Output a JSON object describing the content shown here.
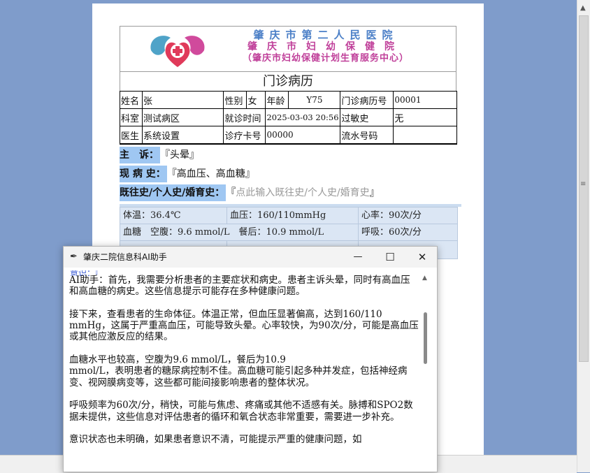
{
  "header": {
    "hospital_line1": "肇庆市第二人民医院",
    "hospital_line2": "肇庆市妇幼保健院",
    "hospital_line3": "（肇庆市妇幼保健计划生育服务中心）"
  },
  "record_title": "门诊病历",
  "info": {
    "name_label": "姓名",
    "name_value": "张",
    "gender_label": "性别",
    "gender_value": "女",
    "age_label": "年龄",
    "age_value": "Y75",
    "record_no_label": "门诊病历号",
    "record_no_value": "00001",
    "dept_label": "科室",
    "dept_value": "测试病区",
    "visit_time_label": "就诊时间",
    "visit_time_value": "2025-03-03 20:56",
    "allergy_label": "过敏史",
    "allergy_value": "无",
    "doctor_label": "医生",
    "doctor_value": "系统设置",
    "card_label": "诊疗卡号",
    "card_value": "00000",
    "serial_label": "流水号码",
    "serial_value": ""
  },
  "sections": {
    "chief_label": "主　诉：",
    "chief_value": "『头晕』",
    "present_label": "现 病 史：",
    "present_value": "『高血压、高血糖』",
    "past_label": "既往史/个人史/婚育史：",
    "past_open": "『",
    "past_placeholder": "点此输入既往史/个人史/婚育史",
    "past_close": "』"
  },
  "vitals": {
    "temp": "体温：36.4℃",
    "bp": "血压：160/110mmHg",
    "hr": "心率：90次/分",
    "glucose": "血糖　空腹：9.6 mmol/L　餐后：10.9 mmol/L",
    "resp": "呼吸：60次/分",
    "partial_row": "",
    "partial_right": ""
  },
  "ai_window": {
    "title": "肇庆二院信息科AI助手",
    "minimize": "—",
    "maximize": "☐",
    "close": "✕",
    "cut_line": "意识：『",
    "body": "AI助手：首先，我需要分析患者的主要症状和病史。患者主诉头晕，同时有高血压和高血糖的病史。这些信息提示可能存在多种健康问题。\n\n接下来，查看患者的生命体征。体温正常，但血压显著偏高，达到160/110\nmmHg，这属于严重高血压，可能导致头晕。心率较快，为90次/分，可能是高血压或其他应激反应的结果。\n\n血糖水平也较高，空腹为9.6 mmol/L，餐后为10.9\nmmol/L，表明患者的糖尿病控制不佳。高血糖可能引起多种并发症，包括神经病变、视网膜病变等，这些都可能间接影响患者的整体状况。\n\n呼吸频率为60次/分，稍快，可能与焦虑、疼痛或其他不适感有关。脉搏和SPO2数据未提供，这些信息对评估患者的循环和氧合状态非常重要，需要进一步补充。\n\n意识状态也未明确，如果患者意识不清，可能提示严重的健康问题，如"
  },
  "colors": {
    "desktop": "#7f9ccb",
    "section_label_bg": "#9fc7f2",
    "hospital_pink": "#c0409a",
    "hospital_blue": "#4b7fc7"
  }
}
